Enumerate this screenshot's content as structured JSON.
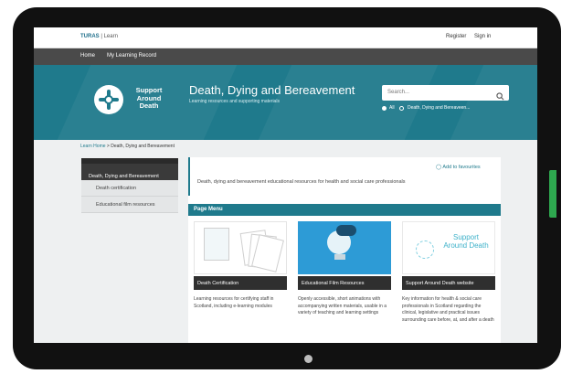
{
  "topbar": {
    "brand_bold": "TURAS",
    "brand_rest": "| Learn",
    "register_label": "Register",
    "signin_label": "Sign in"
  },
  "nav": {
    "items": [
      {
        "label": "Home"
      },
      {
        "label": "My Learning Record"
      }
    ]
  },
  "banner": {
    "logo_text": "Support Around Death",
    "title": "Death, Dying and Bereavement",
    "subtitle": "Learning resources and supporting materials",
    "search": {
      "placeholder": "Search...",
      "options": [
        {
          "label": "All",
          "selected": false
        },
        {
          "label": "Death, Dying and Bereaveen...",
          "selected": true
        }
      ]
    },
    "color": "#1f7a8c"
  },
  "breadcrumb": {
    "home": "Learn Home",
    "separator": ">",
    "current": "Death, Dying and Bereavement"
  },
  "sidebar": {
    "active": "Death, Dying and Bereavement",
    "items": [
      {
        "label": "Death certification"
      },
      {
        "label": "Educational film resources"
      }
    ]
  },
  "content": {
    "favourite_label": "Add to favourites",
    "intro": "Death, dying and bereavement educational resources for health and social care professionals",
    "page_menu_label": "Page Menu",
    "cards": [
      {
        "caption": "Death Certification",
        "description": "Learning resources for certifying staff in Scotland, including e-learning modules"
      },
      {
        "caption": "Educational Film Resources",
        "description": "Openly accessible, short animations with accompanying written materials, usable in a variety of teaching and learning settings"
      },
      {
        "caption": "Support Around Death website",
        "description": "Key information for health & social care professionals in Scotland regarding the clinical, legislative and practical issues surrounding care before, at, and after a death",
        "image_logo": "Support Around Death"
      }
    ]
  },
  "colors": {
    "accent": "#1f7a8c",
    "nav": "#4a4a4a",
    "feedback": "#2ea84f"
  }
}
